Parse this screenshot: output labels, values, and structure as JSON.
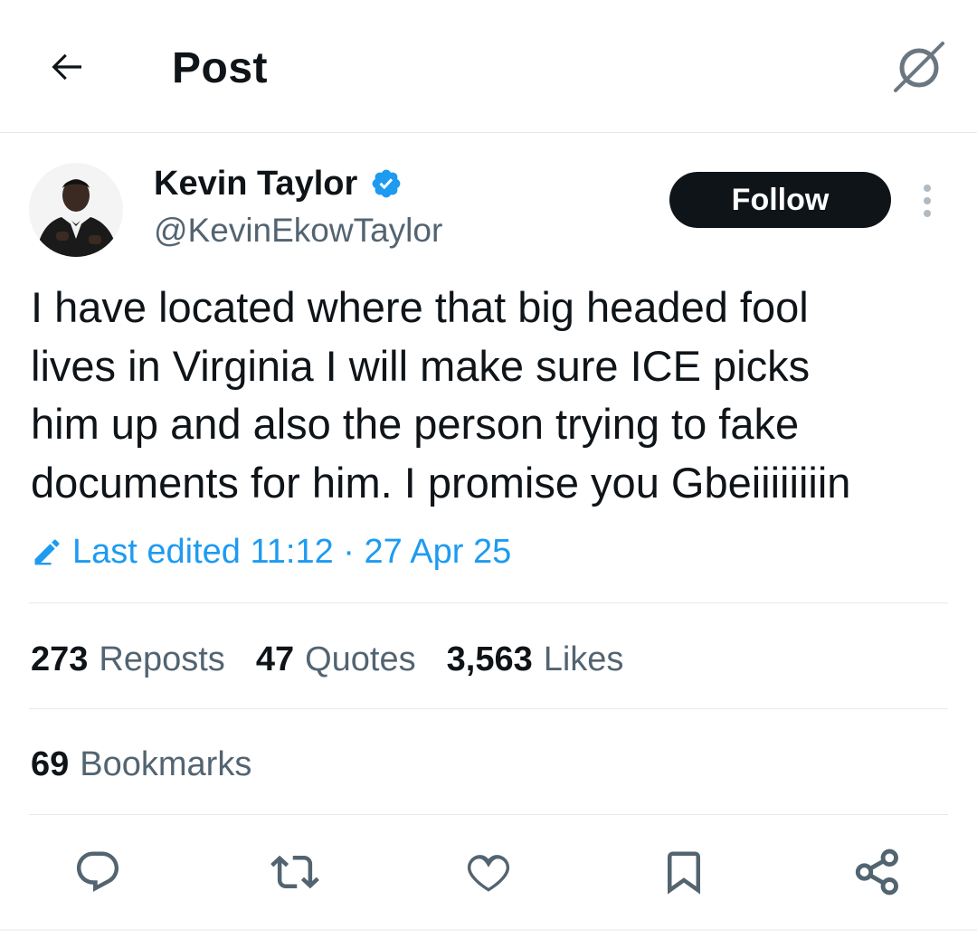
{
  "header": {
    "title": "Post",
    "back_icon": "arrow-left-icon",
    "grok_icon": "grok-icon"
  },
  "author": {
    "display_name": "Kevin Taylor",
    "handle": "@KevinEkowTaylor",
    "verified": true,
    "verified_color": "#1d9bf0",
    "follow_label": "Follow"
  },
  "post": {
    "text": "I have located where that big headed fool\nlives in Virginia I will make sure ICE picks\nhim up and also the person trying to fake\ndocuments for him. I promise you Gbeiiiiiiiin",
    "edited_label": "Last edited 11:12 · 27 Apr 25"
  },
  "stats": {
    "reposts": {
      "count": "273",
      "label": "Reposts"
    },
    "quotes": {
      "count": "47",
      "label": "Quotes"
    },
    "likes": {
      "count": "3,563",
      "label": "Likes"
    },
    "bookmarks": {
      "count": "69",
      "label": "Bookmarks"
    }
  },
  "actions": [
    "reply-icon",
    "repost-icon",
    "like-icon",
    "bookmark-icon",
    "share-icon"
  ],
  "colors": {
    "text": "#0f1419",
    "secondary": "#536471",
    "accent": "#1d9bf0",
    "divider": "#e6e9ec"
  }
}
